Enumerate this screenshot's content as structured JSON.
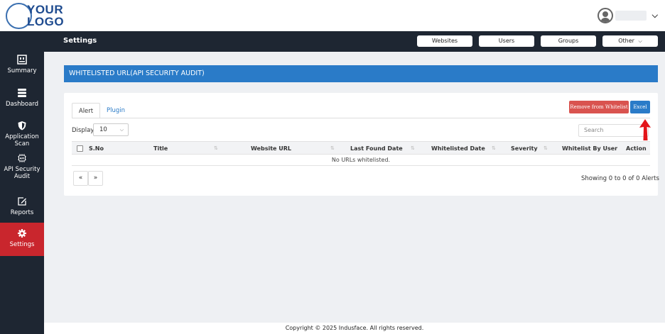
{
  "logo": {
    "line1": "YOUR",
    "line2": "LOGO"
  },
  "header": {
    "page_title": "Settings"
  },
  "top_buttons": {
    "websites": "Websites",
    "users": "Users",
    "groups": "Groups",
    "other": "Other"
  },
  "sidebar": {
    "items": [
      {
        "label": "Summary",
        "icon": "summary-icon"
      },
      {
        "label": "Dashboard",
        "icon": "dashboard-icon"
      },
      {
        "label": "Application Scan",
        "icon": "shield-icon"
      },
      {
        "label": "API Security Audit",
        "icon": "api-icon"
      },
      {
        "label": "Reports",
        "icon": "edit-icon"
      },
      {
        "label": "Settings",
        "icon": "gear-icon"
      }
    ]
  },
  "banner": {
    "title": "WHITELISTED URL(API SECURITY AUDIT)"
  },
  "tabs": {
    "alert": "Alert",
    "plugin": "Plugin"
  },
  "actions": {
    "remove": "Remove from Whitelist",
    "excel": "Excel"
  },
  "display": {
    "label": "Display",
    "value": "10"
  },
  "search": {
    "placeholder": "Search"
  },
  "table": {
    "columns": [
      "S.No",
      "Title",
      "Website URL",
      "Last Found Date",
      "Whitelisted Date",
      "Severity",
      "Whitelist By User",
      "Action"
    ],
    "empty_message": "No URLs whitelisted."
  },
  "pagination": {
    "prev": "«",
    "next": "»",
    "summary": "Showing 0 to 0 of 0 Alerts"
  },
  "footer": {
    "copyright": "Copyright © 2025 Indusface. All rights reserved."
  },
  "colors": {
    "sidebar_bg": "#1e2632",
    "active": "#c9262d",
    "accent": "#2a7bc8",
    "danger": "#d9534f"
  }
}
